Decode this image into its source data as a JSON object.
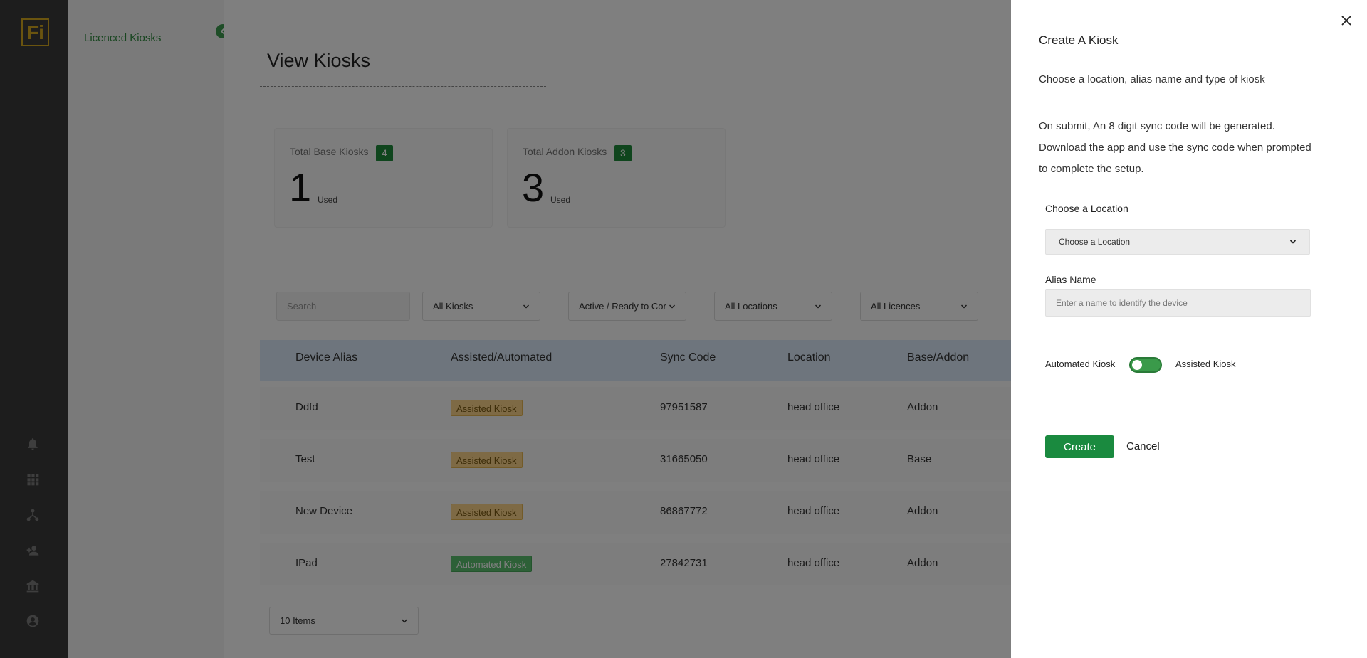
{
  "brand": {
    "logo_text": "Fi"
  },
  "subnav": {
    "link_label": "Licenced Kiosks"
  },
  "page": {
    "title": "View Kiosks"
  },
  "stats": [
    {
      "label": "Total Base Kiosks",
      "badge": "4",
      "value": "1",
      "suffix": "Used"
    },
    {
      "label": "Total Addon Kiosks",
      "badge": "3",
      "value": "3",
      "suffix": "Used"
    }
  ],
  "filters": {
    "search_placeholder": "Search",
    "kiosks": "All Kiosks",
    "status": "Active / Ready to Cor",
    "locations": "All Locations",
    "licences": "All Licences"
  },
  "table": {
    "headers": [
      "Device Alias",
      "Assisted/Automated",
      "Sync Code",
      "Location",
      "Base/Addon"
    ],
    "rows": [
      {
        "alias": "Ddfd",
        "type": "Assisted Kiosk",
        "sync": "97951587",
        "location": "head office",
        "plan": "Addon"
      },
      {
        "alias": "Test",
        "type": "Assisted Kiosk",
        "sync": "31665050",
        "location": "head office",
        "plan": "Base"
      },
      {
        "alias": "New Device",
        "type": "Assisted Kiosk",
        "sync": "86867772",
        "location": "head office",
        "plan": "Addon"
      },
      {
        "alias": "IPad",
        "type": "Automated Kiosk",
        "sync": "27842731",
        "location": "head office",
        "plan": "Addon"
      }
    ]
  },
  "pagination": {
    "page_size": "10 Items"
  },
  "drawer": {
    "title": "Create A Kiosk",
    "subtitle": "Choose a location, alias name and type of kiosk",
    "info_1": "On submit, An 8 digit sync code will be generated.",
    "info_2": "Download the app and use the sync code when prompted",
    "info_3": "to complete the setup.",
    "location_label": "Choose a Location",
    "location_value": "Choose a Location",
    "alias_label": "Alias Name",
    "alias_placeholder": "Enter a name to identify the device",
    "toggle_left": "Automated Kiosk",
    "toggle_right": "Assisted Kiosk",
    "create_label": "Create",
    "cancel_label": "Cancel"
  },
  "colors": {
    "accent": "#1a8a3f",
    "assisted": "#fcd48a",
    "automated": "#5bc06f",
    "header": "#dcebfb"
  }
}
